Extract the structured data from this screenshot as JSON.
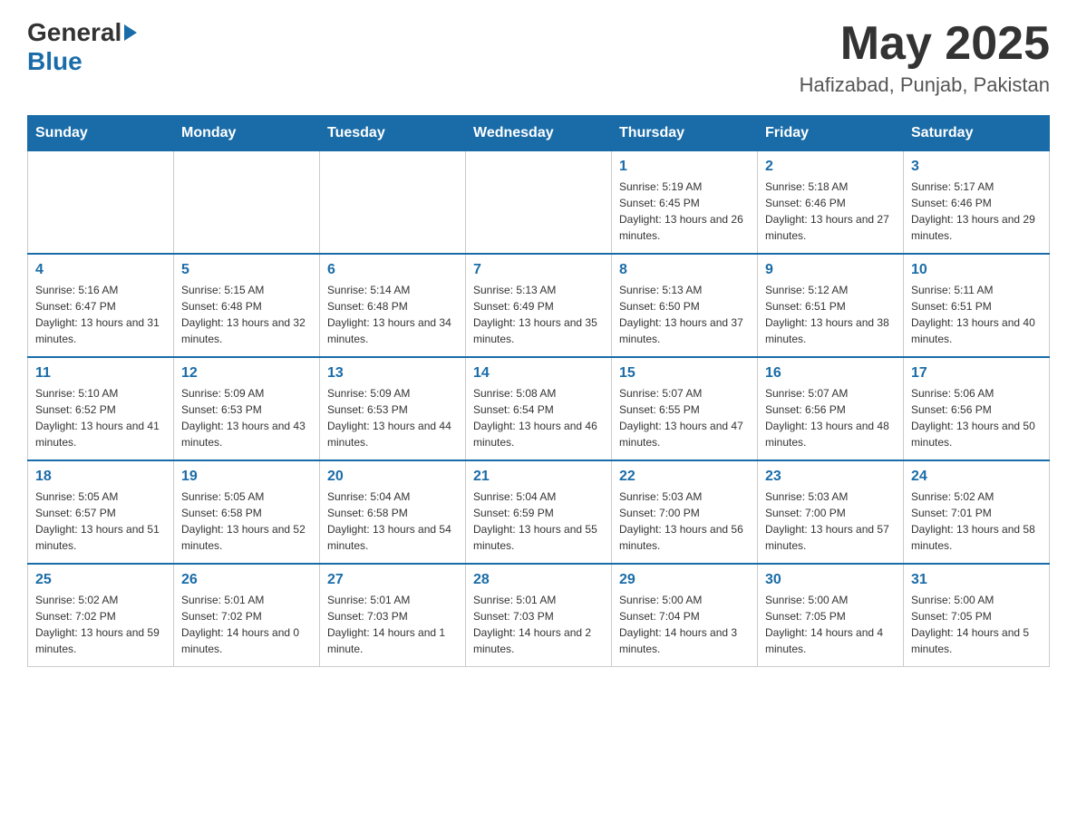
{
  "header": {
    "logo_general": "General",
    "logo_blue": "Blue",
    "month_title": "May 2025",
    "location": "Hafizabad, Punjab, Pakistan"
  },
  "days_of_week": [
    "Sunday",
    "Monday",
    "Tuesday",
    "Wednesday",
    "Thursday",
    "Friday",
    "Saturday"
  ],
  "weeks": [
    [
      {
        "day": "",
        "sunrise": "",
        "sunset": "",
        "daylight": ""
      },
      {
        "day": "",
        "sunrise": "",
        "sunset": "",
        "daylight": ""
      },
      {
        "day": "",
        "sunrise": "",
        "sunset": "",
        "daylight": ""
      },
      {
        "day": "",
        "sunrise": "",
        "sunset": "",
        "daylight": ""
      },
      {
        "day": "1",
        "sunrise": "Sunrise: 5:19 AM",
        "sunset": "Sunset: 6:45 PM",
        "daylight": "Daylight: 13 hours and 26 minutes."
      },
      {
        "day": "2",
        "sunrise": "Sunrise: 5:18 AM",
        "sunset": "Sunset: 6:46 PM",
        "daylight": "Daylight: 13 hours and 27 minutes."
      },
      {
        "day": "3",
        "sunrise": "Sunrise: 5:17 AM",
        "sunset": "Sunset: 6:46 PM",
        "daylight": "Daylight: 13 hours and 29 minutes."
      }
    ],
    [
      {
        "day": "4",
        "sunrise": "Sunrise: 5:16 AM",
        "sunset": "Sunset: 6:47 PM",
        "daylight": "Daylight: 13 hours and 31 minutes."
      },
      {
        "day": "5",
        "sunrise": "Sunrise: 5:15 AM",
        "sunset": "Sunset: 6:48 PM",
        "daylight": "Daylight: 13 hours and 32 minutes."
      },
      {
        "day": "6",
        "sunrise": "Sunrise: 5:14 AM",
        "sunset": "Sunset: 6:48 PM",
        "daylight": "Daylight: 13 hours and 34 minutes."
      },
      {
        "day": "7",
        "sunrise": "Sunrise: 5:13 AM",
        "sunset": "Sunset: 6:49 PM",
        "daylight": "Daylight: 13 hours and 35 minutes."
      },
      {
        "day": "8",
        "sunrise": "Sunrise: 5:13 AM",
        "sunset": "Sunset: 6:50 PM",
        "daylight": "Daylight: 13 hours and 37 minutes."
      },
      {
        "day": "9",
        "sunrise": "Sunrise: 5:12 AM",
        "sunset": "Sunset: 6:51 PM",
        "daylight": "Daylight: 13 hours and 38 minutes."
      },
      {
        "day": "10",
        "sunrise": "Sunrise: 5:11 AM",
        "sunset": "Sunset: 6:51 PM",
        "daylight": "Daylight: 13 hours and 40 minutes."
      }
    ],
    [
      {
        "day": "11",
        "sunrise": "Sunrise: 5:10 AM",
        "sunset": "Sunset: 6:52 PM",
        "daylight": "Daylight: 13 hours and 41 minutes."
      },
      {
        "day": "12",
        "sunrise": "Sunrise: 5:09 AM",
        "sunset": "Sunset: 6:53 PM",
        "daylight": "Daylight: 13 hours and 43 minutes."
      },
      {
        "day": "13",
        "sunrise": "Sunrise: 5:09 AM",
        "sunset": "Sunset: 6:53 PM",
        "daylight": "Daylight: 13 hours and 44 minutes."
      },
      {
        "day": "14",
        "sunrise": "Sunrise: 5:08 AM",
        "sunset": "Sunset: 6:54 PM",
        "daylight": "Daylight: 13 hours and 46 minutes."
      },
      {
        "day": "15",
        "sunrise": "Sunrise: 5:07 AM",
        "sunset": "Sunset: 6:55 PM",
        "daylight": "Daylight: 13 hours and 47 minutes."
      },
      {
        "day": "16",
        "sunrise": "Sunrise: 5:07 AM",
        "sunset": "Sunset: 6:56 PM",
        "daylight": "Daylight: 13 hours and 48 minutes."
      },
      {
        "day": "17",
        "sunrise": "Sunrise: 5:06 AM",
        "sunset": "Sunset: 6:56 PM",
        "daylight": "Daylight: 13 hours and 50 minutes."
      }
    ],
    [
      {
        "day": "18",
        "sunrise": "Sunrise: 5:05 AM",
        "sunset": "Sunset: 6:57 PM",
        "daylight": "Daylight: 13 hours and 51 minutes."
      },
      {
        "day": "19",
        "sunrise": "Sunrise: 5:05 AM",
        "sunset": "Sunset: 6:58 PM",
        "daylight": "Daylight: 13 hours and 52 minutes."
      },
      {
        "day": "20",
        "sunrise": "Sunrise: 5:04 AM",
        "sunset": "Sunset: 6:58 PM",
        "daylight": "Daylight: 13 hours and 54 minutes."
      },
      {
        "day": "21",
        "sunrise": "Sunrise: 5:04 AM",
        "sunset": "Sunset: 6:59 PM",
        "daylight": "Daylight: 13 hours and 55 minutes."
      },
      {
        "day": "22",
        "sunrise": "Sunrise: 5:03 AM",
        "sunset": "Sunset: 7:00 PM",
        "daylight": "Daylight: 13 hours and 56 minutes."
      },
      {
        "day": "23",
        "sunrise": "Sunrise: 5:03 AM",
        "sunset": "Sunset: 7:00 PM",
        "daylight": "Daylight: 13 hours and 57 minutes."
      },
      {
        "day": "24",
        "sunrise": "Sunrise: 5:02 AM",
        "sunset": "Sunset: 7:01 PM",
        "daylight": "Daylight: 13 hours and 58 minutes."
      }
    ],
    [
      {
        "day": "25",
        "sunrise": "Sunrise: 5:02 AM",
        "sunset": "Sunset: 7:02 PM",
        "daylight": "Daylight: 13 hours and 59 minutes."
      },
      {
        "day": "26",
        "sunrise": "Sunrise: 5:01 AM",
        "sunset": "Sunset: 7:02 PM",
        "daylight": "Daylight: 14 hours and 0 minutes."
      },
      {
        "day": "27",
        "sunrise": "Sunrise: 5:01 AM",
        "sunset": "Sunset: 7:03 PM",
        "daylight": "Daylight: 14 hours and 1 minute."
      },
      {
        "day": "28",
        "sunrise": "Sunrise: 5:01 AM",
        "sunset": "Sunset: 7:03 PM",
        "daylight": "Daylight: 14 hours and 2 minutes."
      },
      {
        "day": "29",
        "sunrise": "Sunrise: 5:00 AM",
        "sunset": "Sunset: 7:04 PM",
        "daylight": "Daylight: 14 hours and 3 minutes."
      },
      {
        "day": "30",
        "sunrise": "Sunrise: 5:00 AM",
        "sunset": "Sunset: 7:05 PM",
        "daylight": "Daylight: 14 hours and 4 minutes."
      },
      {
        "day": "31",
        "sunrise": "Sunrise: 5:00 AM",
        "sunset": "Sunset: 7:05 PM",
        "daylight": "Daylight: 14 hours and 5 minutes."
      }
    ]
  ]
}
